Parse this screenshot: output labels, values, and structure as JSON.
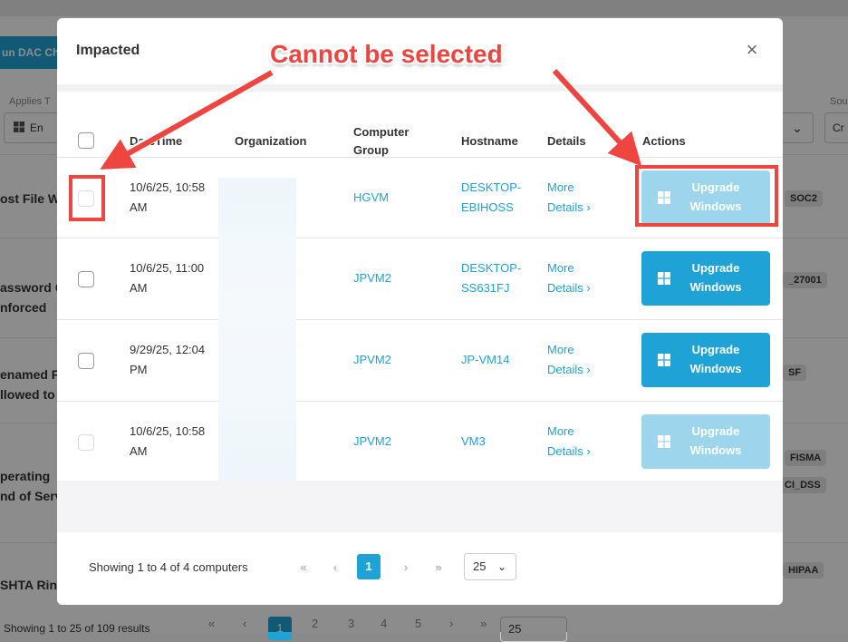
{
  "background": {
    "run_button_label": "un DAC Ch",
    "applies_label": "Applies T",
    "applies_value": "En",
    "source_label": "Sou",
    "cr_label": "Cr",
    "rows": [
      {
        "line1": "ost File W",
        "line2": "",
        "tag": "SOC2"
      },
      {
        "line1": "assword C",
        "line2": "nforced",
        "tag": "_27001"
      },
      {
        "line1": "enamed F",
        "line2": "llowed to",
        "tag": "SF"
      },
      {
        "line1": "perating",
        "line2": "nd of Serv",
        "tag": "FISMA",
        "tag2": "CI_DSS"
      },
      {
        "line1": "SHTA Rin",
        "line2": "",
        "tag": "HIPAA"
      }
    ],
    "footer_showing": "Showing 1 to 25 of 109 results",
    "pager": [
      "«",
      "‹",
      "1",
      "2",
      "3",
      "4",
      "5",
      "›",
      "»"
    ],
    "per_page": "25"
  },
  "modal": {
    "title": "Impacted",
    "close_label": "×",
    "columns": {
      "datetime": "DateTime",
      "organization": "Organization",
      "computer_group": "Computer Group",
      "hostname": "Hostname",
      "details": "Details",
      "actions": "Actions"
    },
    "rows": [
      {
        "datetime": "10/6/25, 10:58 AM",
        "organization": "",
        "group": "HGVM",
        "hostname": "DESKTOP-EBIHOSS",
        "details": "More Details",
        "action": "Upgrade Windows",
        "selectable": false
      },
      {
        "datetime": "10/6/25, 11:00 AM",
        "organization": "",
        "group": "JPVM2",
        "hostname": "DESKTOP-SS631FJ",
        "details": "More Details",
        "action": "Upgrade Windows",
        "selectable": true
      },
      {
        "datetime": "9/29/25, 12:04 PM",
        "organization": "",
        "group": "JPVM2",
        "hostname": "JP-VM14",
        "details": "More Details",
        "action": "Upgrade Windows",
        "selectable": true
      },
      {
        "datetime": "10/6/25, 10:58 AM",
        "organization": "",
        "group": "JPVM2",
        "hostname": "VM3",
        "details": "More Details",
        "action": "Upgrade Windows",
        "selectable": false
      }
    ],
    "footer": {
      "showing": "Showing 1 to 4 of 4 computers",
      "first": "«",
      "prev": "‹",
      "current_page": "1",
      "next": "›",
      "last": "»",
      "per_page": "25"
    }
  },
  "annotation": {
    "text": "Cannot be selected",
    "color": "#ee4540"
  },
  "colors": {
    "accent": "#1fa3d6",
    "accent_disabled": "#9dd6ec"
  }
}
